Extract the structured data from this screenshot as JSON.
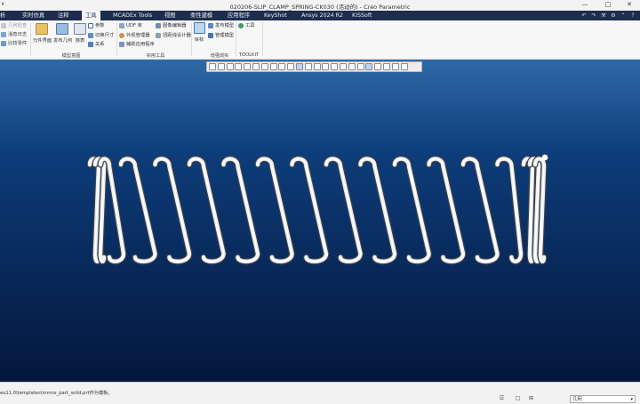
{
  "window": {
    "title": "020206-SLIP_CLAMP_SPRING-CK030 (活动的) - Creo Parametric",
    "left_glyph": "∨",
    "controls": {
      "minimize": "—",
      "maximize": "□",
      "close": "✕"
    }
  },
  "tabs": [
    "析",
    "实时仿真",
    "注释",
    "工具",
    "MCADEx Tools",
    "视图",
    "柔性建模",
    "应用程序",
    "KeyShot",
    "Ansys 2024 R2",
    "KISSoft"
  ],
  "active_tab": "工具",
  "tab_icons": [
    "↶",
    "↷",
    "⚒",
    "⚙",
    "⌃",
    "?"
  ],
  "ribbon": {
    "left_items": [
      "几何检查",
      "消息日志",
      "比较零件"
    ],
    "model_intent": {
      "label": "模型意图",
      "buttons": [
        "元件界面",
        "发布几何",
        "族表"
      ],
      "items": [
        "参数",
        "切换尺寸",
        "关系"
      ]
    },
    "utilities": {
      "label": "实用工具",
      "items": [
        "UDF 库",
        "外观管理器",
        "辅助应用程序",
        "图像编辑器",
        "扭距线设计器"
      ]
    },
    "enhanced_reality": {
      "label": "增强现实",
      "button": "目标",
      "items": [
        "发布模型",
        "管理模型"
      ]
    },
    "toolkit": {
      "label": "TOOLKIT",
      "item": "工具"
    }
  },
  "status": {
    "message": "eo11.0\\templates\\mmns_part_solid.prt作为模板。",
    "filter_value": "几何",
    "filter_arrow": "▾",
    "icons": [
      "☲",
      "□",
      "⊞"
    ]
  }
}
